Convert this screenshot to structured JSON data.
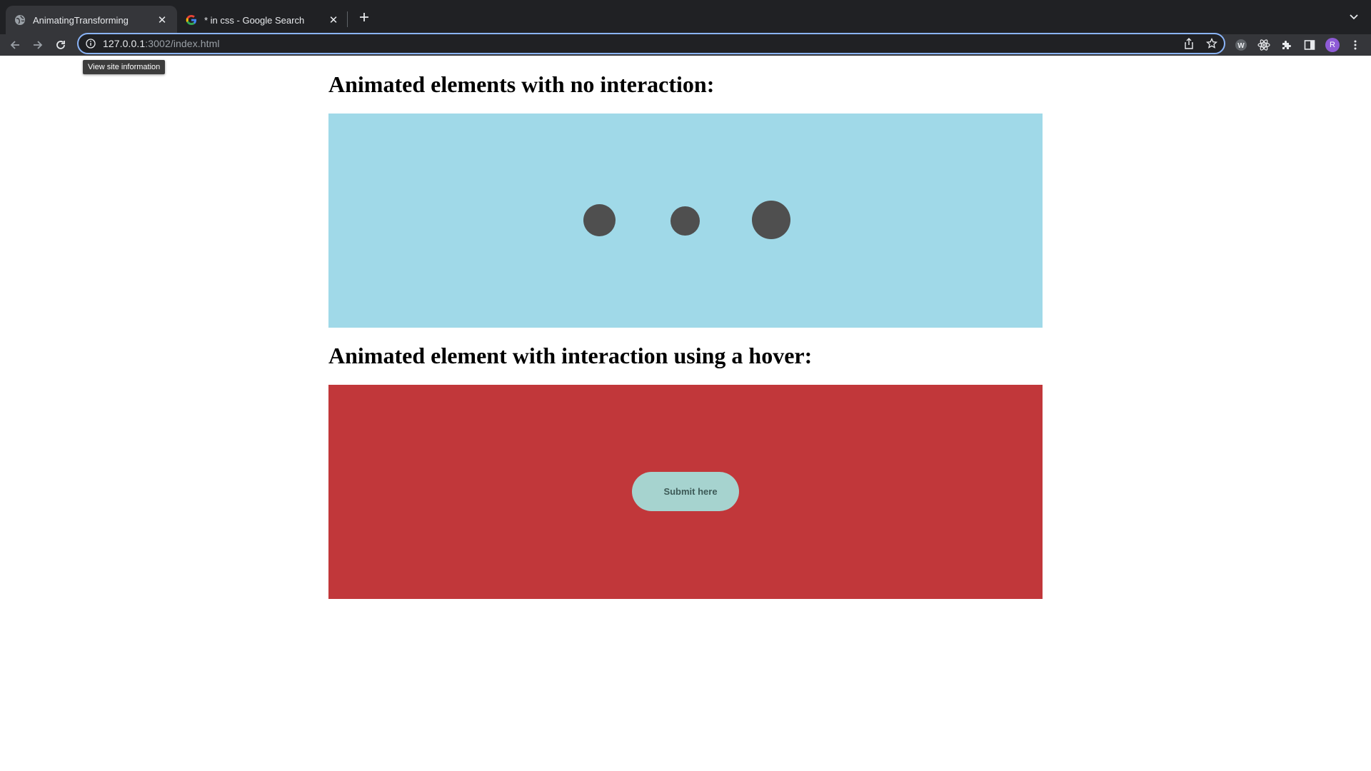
{
  "browser": {
    "tabs": [
      {
        "title": "AnimatingTransforming",
        "active": true,
        "icon": "globe-icon"
      },
      {
        "title": "* in css - Google Search",
        "active": false,
        "icon": "google-g-icon"
      }
    ],
    "url": {
      "host": "127.0.0.1",
      "rest": ":3002/index.html"
    },
    "tooltip": "View site information",
    "profile_initial": "R",
    "colors": {
      "chrome_dark": "#202124",
      "chrome_toolbar": "#35363a",
      "focus_ring": "#8ab4f8",
      "profile": "#8e5bd6"
    }
  },
  "page": {
    "heading_1": "Animated elements with no interaction:",
    "heading_2": "Animated element with interaction using a hover:",
    "submit_label": "Submit here",
    "colors": {
      "blue_box": "#a0d9e8",
      "red_box": "#c1373a",
      "dots": "#4f4f4f",
      "button": "#a6d3cf"
    }
  }
}
